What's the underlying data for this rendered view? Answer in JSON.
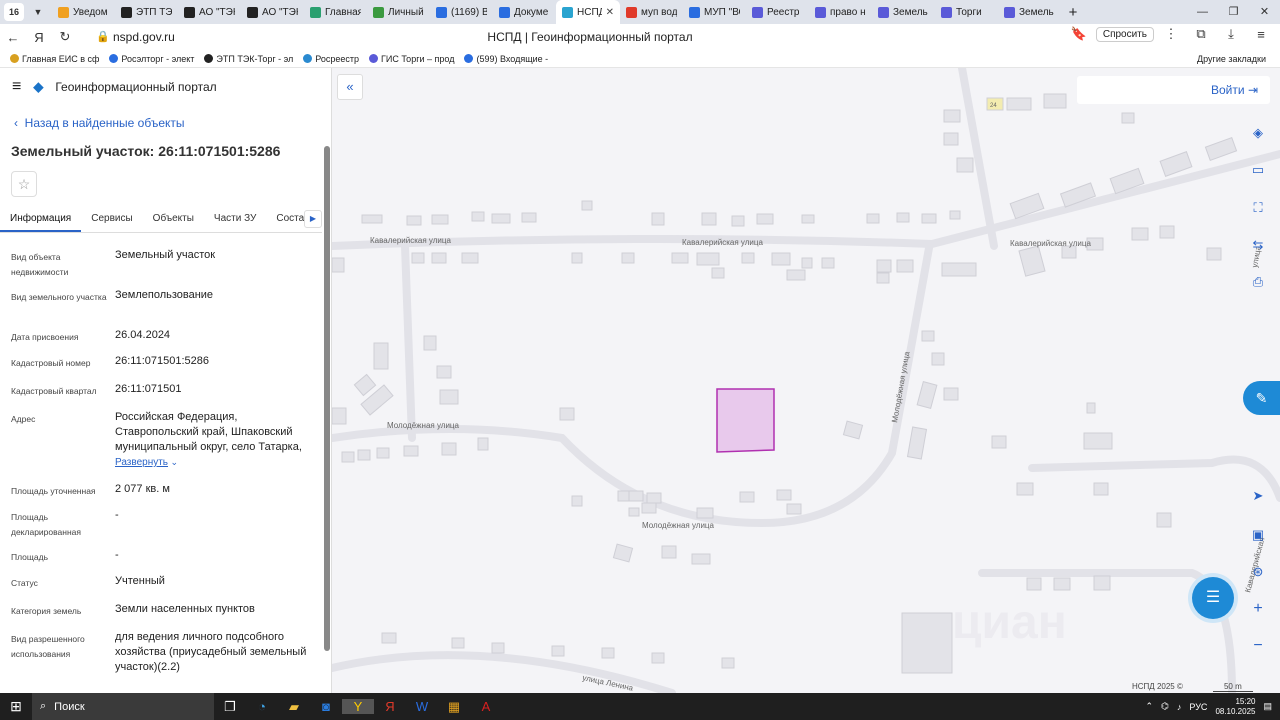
{
  "browser": {
    "tab_count": "16",
    "tabs": [
      {
        "label": "Уведом",
        "color": "#f0a020"
      },
      {
        "label": "ЭТП ТЭК",
        "color": "#222222"
      },
      {
        "label": "АО \"ТЭК",
        "color": "#222222"
      },
      {
        "label": "АО \"ТЭК",
        "color": "#222222"
      },
      {
        "label": "Главная",
        "color": "#2aa070"
      },
      {
        "label": "Личный",
        "color": "#3b9a40"
      },
      {
        "label": "(1169) В",
        "color": "#2a6de0"
      },
      {
        "label": "Докуме",
        "color": "#2a6de0"
      },
      {
        "label": "НСПД",
        "color": "#2aa4d0",
        "active": true
      },
      {
        "label": "муп вод",
        "color": "#e03a2a"
      },
      {
        "label": "МУП \"ВС",
        "color": "#2a6de0"
      },
      {
        "label": "Реестр",
        "color": "#5a5ad8"
      },
      {
        "label": "право н",
        "color": "#5a5ad8"
      },
      {
        "label": "Земель",
        "color": "#5a5ad8"
      },
      {
        "label": "Торги",
        "color": "#5a5ad8"
      },
      {
        "label": "Земель",
        "color": "#5a5ad8"
      }
    ],
    "url": "nspd.gov.ru",
    "page_title": "НСПД | Геоинформационный портал",
    "ask_label": "Спросить",
    "bookmarks": [
      {
        "label": "Главная ЕИС в сф",
        "color": "#d8a020"
      },
      {
        "label": "Росэлторг - элект",
        "color": "#2a6de0"
      },
      {
        "label": "ЭТП ТЭК-Торг - эл",
        "color": "#222222"
      },
      {
        "label": "Росреестр",
        "color": "#2a8ad0"
      },
      {
        "label": "ГИС Торги – прод",
        "color": "#5a5ad8"
      },
      {
        "label": "(599) Входящие -",
        "color": "#2a6de0"
      }
    ],
    "other_bookmarks": "Другие закладки"
  },
  "portal": {
    "title": "Геоинформационный портал",
    "back_link": "Назад в найденные объекты",
    "object_title": "Земельный участок: 26:11:071501:5286",
    "tabs": [
      "Информация",
      "Сервисы",
      "Объекты",
      "Части ЗУ",
      "Соста"
    ],
    "fields": [
      {
        "key": "Вид объекта недвижимости",
        "value": "Земельный участок"
      },
      {
        "key": "Вид земельного участка",
        "value": "Землепользование"
      },
      {
        "key": "Дата присвоения",
        "value": "26.04.2024"
      },
      {
        "key": "Кадастровый номер",
        "value": "26:11:071501:5286"
      },
      {
        "key": "Кадастровый квартал",
        "value": "26:11:071501"
      },
      {
        "key": "Адрес",
        "value": "Российская Федерация, Ставропольский край, Шпаковский муниципальный округ, село Татарка,"
      },
      {
        "key": "Площадь уточненная",
        "value": "2 077 кв. м"
      },
      {
        "key": "Площадь декларированная",
        "value": "-"
      },
      {
        "key": "Площадь",
        "value": "-"
      },
      {
        "key": "Статус",
        "value": "Учтенный"
      },
      {
        "key": "Категория земель",
        "value": "Земли населенных пунктов"
      },
      {
        "key": "Вид разрешенного использования",
        "value": "для ведения личного подсобного хозяйства (приусадебный земельный участок)(2.2)"
      }
    ],
    "expand_label": "Развернуть"
  },
  "map": {
    "login_label": "Войти",
    "streets": {
      "kav1": "Кавалерийская улица",
      "kav2": "Кавалерийская улица",
      "kav3": "Кавалерийская улица",
      "mol1": "Молодёжная улица",
      "mol2": "Молодёжная улица",
      "mol3": "Молодёжная улица",
      "lenina": "улица Ленина",
      "right_top": "улица",
      "right_bottom": "Кавалерийская"
    },
    "house_number": "24",
    "copyright": "НСПД 2025 ©",
    "scale": "50 m",
    "parcel_color": "#b030b0",
    "watermark": "циан"
  },
  "taskbar": {
    "search_label": "Поиск",
    "lang": "РУС",
    "time": "15:20",
    "date": "08.10.2025"
  }
}
